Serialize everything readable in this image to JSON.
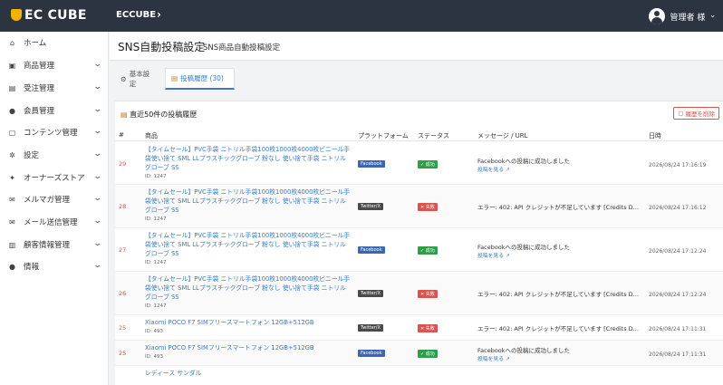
{
  "header": {
    "logo_text": "EC CUBE",
    "site_link": "ECCUBE",
    "site_chevron": "›",
    "user_label": "管理者 様",
    "user_chevron": "›"
  },
  "sidebar": {
    "items": [
      {
        "label": "ホーム",
        "icon": "home-icon",
        "glyph": "⌂",
        "chev": ""
      },
      {
        "label": "商品管理",
        "icon": "box-icon",
        "glyph": "▣",
        "chev": "⌄"
      },
      {
        "label": "受注管理",
        "icon": "cart-icon",
        "glyph": "▤",
        "chev": "⌄"
      },
      {
        "label": "会員管理",
        "icon": "users-icon",
        "glyph": "●",
        "chev": "⌄"
      },
      {
        "label": "コンテンツ管理",
        "icon": "content-icon",
        "glyph": "▢",
        "chev": "⌄"
      },
      {
        "label": "設定",
        "icon": "gear-icon",
        "glyph": "✲",
        "chev": "⌄"
      },
      {
        "label": "オーナーズストア",
        "icon": "store-icon",
        "glyph": "✦",
        "chev": "⌄"
      },
      {
        "label": "メルマガ管理",
        "icon": "mail-icon",
        "glyph": "✉",
        "chev": "⌄"
      },
      {
        "label": "メール送信管理",
        "icon": "mail-send-icon",
        "glyph": "✉",
        "chev": "⌄"
      },
      {
        "label": "顧客情報管理",
        "icon": "customer-icon",
        "glyph": "▥",
        "chev": "⌄"
      },
      {
        "label": "情報",
        "icon": "info-icon",
        "glyph": "●",
        "chev": "⌄"
      }
    ]
  },
  "page": {
    "title": "SNS自動投稿設定",
    "subtitle": "SNS商品自動投稿設定"
  },
  "tabs": [
    {
      "label": "基本設定",
      "glyph": "⚙"
    },
    {
      "label": "投稿履歴 (30)",
      "glyph": "▤"
    }
  ],
  "panel": {
    "title": "直近50件の投稿履歴",
    "delete_label": "履歴を削除"
  },
  "table": {
    "headers": [
      "#",
      "商品",
      "プラットフォーム",
      "ステータス",
      "メッセージ / URL",
      "日時"
    ],
    "rows": [
      {
        "id": "29",
        "product": "【タイムセール】PVC手袋 ニトリル手袋100枚1000枚4000枚ビニール手袋使い捨て SML LLプラスチックグローブ 粉なし 使い捨て手袋 ニトリルグローブ SS",
        "pid": "ID: 1247",
        "platform": "Facebook",
        "ptype": "fb",
        "status": "✓ 成功",
        "stype": "ok",
        "message": "Facebookへの投稿に成功しました",
        "link": "投稿を見る ↗",
        "date": "2026/08/24 17:16:19"
      },
      {
        "id": "28",
        "product": "【タイムセール】PVC手袋 ニトリル手袋100枚1000枚4000枚ビニール手袋使い捨て SML LLプラスチックグローブ 粉なし 使い捨て手袋 ニトリルグローブ SS",
        "pid": "ID: 1247",
        "platform": "Twitter/X",
        "ptype": "tw",
        "status": "✕ 失敗",
        "stype": "ng",
        "message": "エラー: 402: API クレジットが不足しています [Credits D...",
        "link": "",
        "date": "2026/08/24 17:16:12"
      },
      {
        "id": "27",
        "product": "【タイムセール】PVC手袋 ニトリル手袋100枚1000枚4000枚ビニール手袋使い捨て SML LLプラスチックグローブ 粉なし 使い捨て手袋 ニトリルグローブ SS",
        "pid": "ID: 1247",
        "platform": "Facebook",
        "ptype": "fb",
        "status": "✓ 成功",
        "stype": "ok",
        "message": "Facebookへの投稿に成功しました",
        "link": "投稿を見る ↗",
        "date": "2026/08/24 17:12:24"
      },
      {
        "id": "26",
        "product": "【タイムセール】PVC手袋 ニトリル手袋100枚1000枚4000枚ビニール手袋使い捨て SML LLプラスチックグローブ 粉なし 使い捨て手袋 ニトリルグローブ SS",
        "pid": "ID: 1247",
        "platform": "Twitter/X",
        "ptype": "tw",
        "status": "✕ 失敗",
        "stype": "ng",
        "message": "エラー: 402: API クレジットが不足しています [Credits D...",
        "link": "",
        "date": "2026/08/24 17:12:24"
      },
      {
        "id": "25",
        "product": "Xiaomi POCO F7 SIMフリースマートフォン 12GB+512GB",
        "pid": "ID: 493",
        "platform": "Twitter/X",
        "ptype": "tw",
        "status": "✕ 失敗",
        "stype": "ng",
        "message": "エラー: 402: API クレジットが不足しています [Credits D...",
        "link": "",
        "date": "2026/08/24 17:11:31"
      },
      {
        "id": "25",
        "product": "Xiaomi POCO F7 SIMフリースマートフォン 12GB+512GB",
        "pid": "ID: 493",
        "platform": "Facebook",
        "ptype": "fb",
        "status": "✓ 成功",
        "stype": "ok",
        "message": "Facebookへの投稿に成功しました",
        "link": "投稿を見る ↗",
        "date": "2026/08/24 17:11:31"
      },
      {
        "id": "",
        "product": "レディース サンダル",
        "pid": "",
        "platform": "",
        "ptype": "",
        "status": "",
        "stype": "",
        "message": "",
        "link": "",
        "date": ""
      }
    ]
  }
}
